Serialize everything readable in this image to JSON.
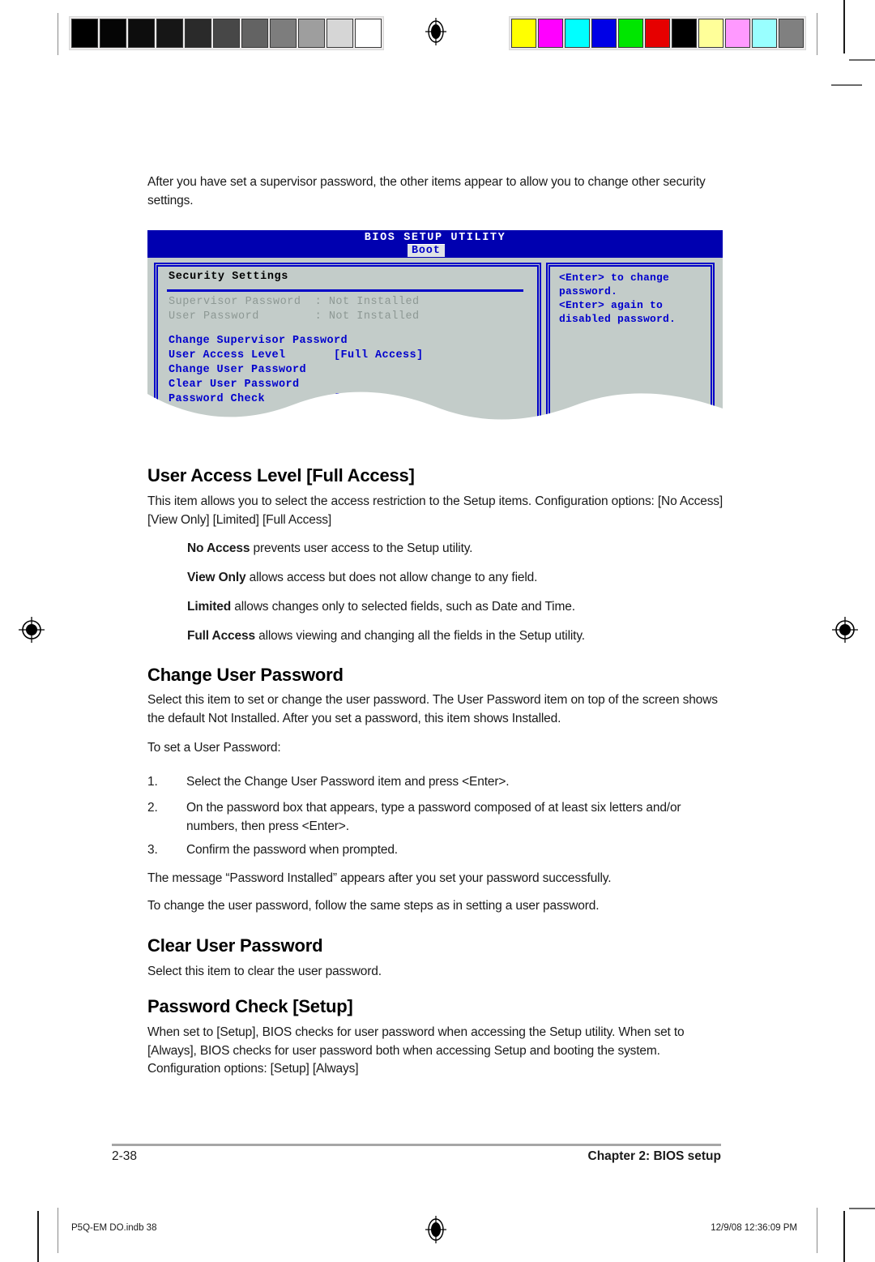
{
  "press": {
    "grayscale_patches": [
      "#000000",
      "#050505",
      "#0d0d0d",
      "#161616",
      "#2a2a2a",
      "#474747",
      "#636363",
      "#7d7d7d",
      "#9e9e9e",
      "#d6d6d6",
      "#ffffff"
    ],
    "color_patches": [
      "#ffff00",
      "#ff00ff",
      "#00ffff",
      "#0000e6",
      "#00e600",
      "#e60000",
      "#000000",
      "#ffff99",
      "#ff99ff",
      "#99ffff",
      "#808080"
    ],
    "registration_icon": "registration-target-icon"
  },
  "intro": {
    "paragraph": "After you have set a supervisor password, the other items appear to allow you to change other security settings."
  },
  "bios": {
    "title": "BIOS SETUP UTILITY",
    "active_tab": "Boot",
    "section_title": "Security Settings",
    "status_rows": [
      "Supervisor Password  : Not Installed",
      "User Password        : Not Installed"
    ],
    "menu_rows": [
      "Change Supervisor Password",
      "User Access Level       [Full Access]",
      "Change User Password",
      "Clear User Password",
      "Password Check          [Setup]"
    ],
    "help_lines": [
      "<Enter> to change",
      "password.",
      "<Enter> again to",
      "disabled password."
    ],
    "colors": {
      "header_bg": "#0000b0",
      "screen_bg": "#c3ccc9",
      "border": "#0000c8",
      "menu_text": "#0000cd",
      "disabled_text": "#8d9894",
      "tab_bg": "#dfe3e6"
    }
  },
  "sections": {
    "user_access_level": {
      "heading": "User Access Level [Full Access]",
      "paragraph": "This item allows you to select the access restriction to the Setup items. Configuration options: [No Access] [View Only] [Limited] [Full Access]",
      "options": [
        {
          "term": "No Access",
          "desc": " prevents user access to the Setup utility."
        },
        {
          "term": "View Only",
          "desc": " allows access but does not allow change to any field."
        },
        {
          "term": "Limited",
          "desc": " allows changes only to selected fields, such as Date and Time."
        },
        {
          "term": "Full Access",
          "desc": " allows viewing and changing all the fields in the Setup utility."
        }
      ]
    },
    "change_user_password": {
      "heading": "Change User Password",
      "paragraph": "Select this item to set or change the user password. The User Password item on top of the screen shows the default Not Installed. After you set a password, this item shows Installed.",
      "lead_in": "To set a User Password:",
      "steps": [
        {
          "num": "1.",
          "text": "Select the Change User Password item and press <Enter>."
        },
        {
          "num": "2.",
          "text": "On the password box that appears, type a password composed of at least six letters and/or numbers, then press <Enter>."
        },
        {
          "num": "3.",
          "text": "Confirm the password when prompted."
        }
      ],
      "note_1": "The message “Password Installed” appears after you set your password successfully.",
      "note_2": "To change the user password, follow the same steps as in setting a user password."
    },
    "clear_user_password": {
      "heading": "Clear User Password",
      "paragraph": "Select this item to clear the user password."
    },
    "password_check": {
      "heading": "Password Check [Setup]",
      "paragraph": "When set to [Setup], BIOS checks for user password when accessing the Setup utility. When set to [Always], BIOS checks for user password both when accessing Setup and booting the system. Configuration options: [Setup] [Always]"
    }
  },
  "footer": {
    "page_number": "2-38",
    "chapter": "Chapter 2: BIOS setup",
    "slug_file": "P5Q-EM DO.indb   38",
    "slug_stamp": "12/9/08   12:36:09 PM"
  }
}
